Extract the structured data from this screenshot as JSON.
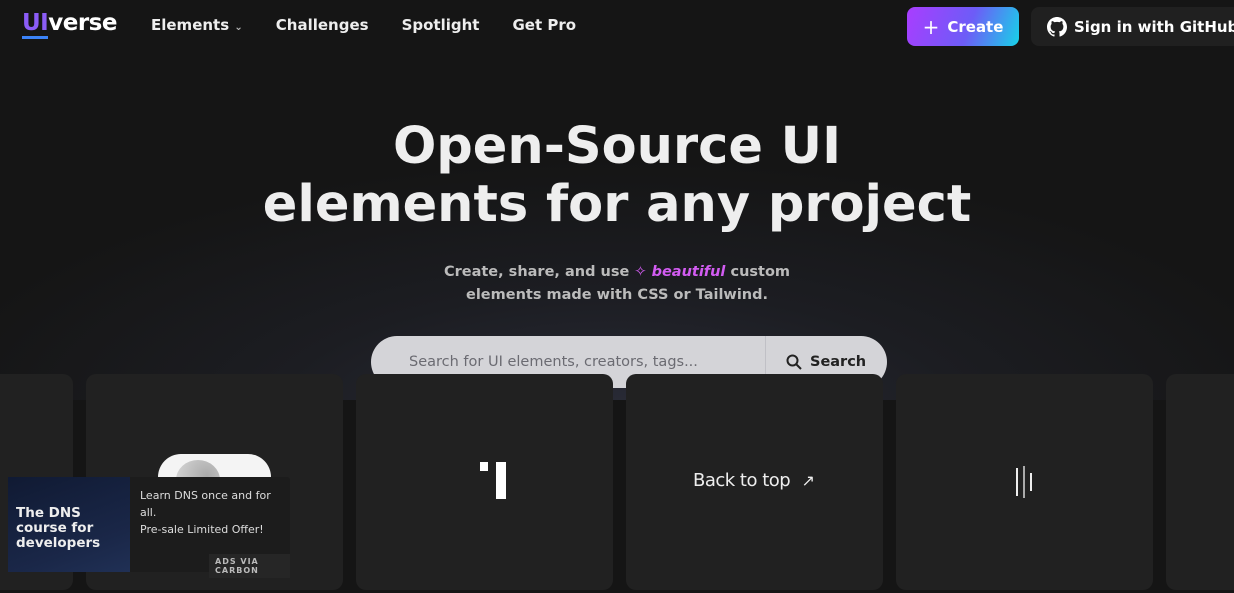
{
  "nav": {
    "logo_ui": "UI",
    "logo_rest": "verse",
    "links": [
      "Elements",
      "Challenges",
      "Spotlight",
      "Get Pro"
    ],
    "create": "Create",
    "github": "Sign in with GitHub"
  },
  "hero": {
    "title_line1": "Open-Source UI",
    "title_line2": "elements for any project",
    "sub_pre": "Create, share, and use",
    "sub_accent": "beautiful",
    "sub_post": "custom",
    "sub_line2": "elements made with CSS or Tailwind.",
    "accent_color": "#d25cf2"
  },
  "search": {
    "placeholder": "Search for UI elements, creators, tags...",
    "button": "Search"
  },
  "ad": {
    "image_text": "The DNS course for developers",
    "line1": "Learn DNS once and for all.",
    "line2": "Pre-sale Limited Offer!",
    "via": "ADS VIA CARBON"
  },
  "cards": {
    "back_to_top": "Back to top"
  }
}
